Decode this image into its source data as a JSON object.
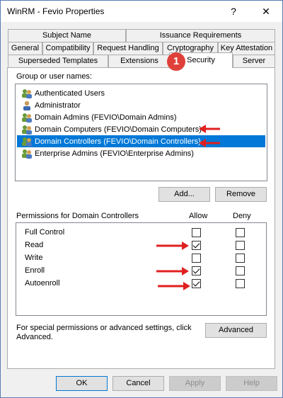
{
  "window": {
    "title": "WinRM - Fevio Properties",
    "help_glyph": "?",
    "close_glyph": "✕"
  },
  "tabs": {
    "row1": [
      "Subject Name",
      "Issuance Requirements"
    ],
    "row2": [
      "General",
      "Compatibility",
      "Request Handling",
      "Cryptography",
      "Key Attestation"
    ],
    "row3": [
      "Superseded Templates",
      "Extensions",
      "Security",
      "Server"
    ],
    "active": "Security"
  },
  "badge": "1",
  "groups": {
    "label": "Group or user names:",
    "items": [
      {
        "name": "Authenticated Users",
        "icon": "group-icon"
      },
      {
        "name": "Administrator",
        "icon": "user-icon"
      },
      {
        "name": "Domain Admins (FEVIO\\Domain Admins)",
        "icon": "group-icon"
      },
      {
        "name": "Domain Computers (FEVIO\\Domain Computers)",
        "icon": "group-icon"
      },
      {
        "name": "Domain Controllers (FEVIO\\Domain Controllers)",
        "icon": "group-icon"
      },
      {
        "name": "Enterprise Admins (FEVIO\\Enterprise Admins)",
        "icon": "group-icon"
      }
    ],
    "selected_index": 4,
    "add_label": "Add...",
    "remove_label": "Remove"
  },
  "permissions": {
    "label": "Permissions for Domain Controllers",
    "allow_header": "Allow",
    "deny_header": "Deny",
    "rows": [
      {
        "name": "Full Control",
        "allow": false,
        "deny": false
      },
      {
        "name": "Read",
        "allow": true,
        "deny": false
      },
      {
        "name": "Write",
        "allow": false,
        "deny": false
      },
      {
        "name": "Enroll",
        "allow": true,
        "deny": false
      },
      {
        "name": "Autoenroll",
        "allow": true,
        "deny": false
      }
    ]
  },
  "advanced": {
    "text_line1": "For special permissions or advanced settings, click",
    "text_line2": "Advanced.",
    "button_label": "Advanced"
  },
  "footer": {
    "ok": "OK",
    "cancel": "Cancel",
    "apply": "Apply",
    "help": "Help"
  },
  "colors": {
    "selection": "#0078d7",
    "arrow": "#e02020",
    "badge": "#e0403a"
  }
}
